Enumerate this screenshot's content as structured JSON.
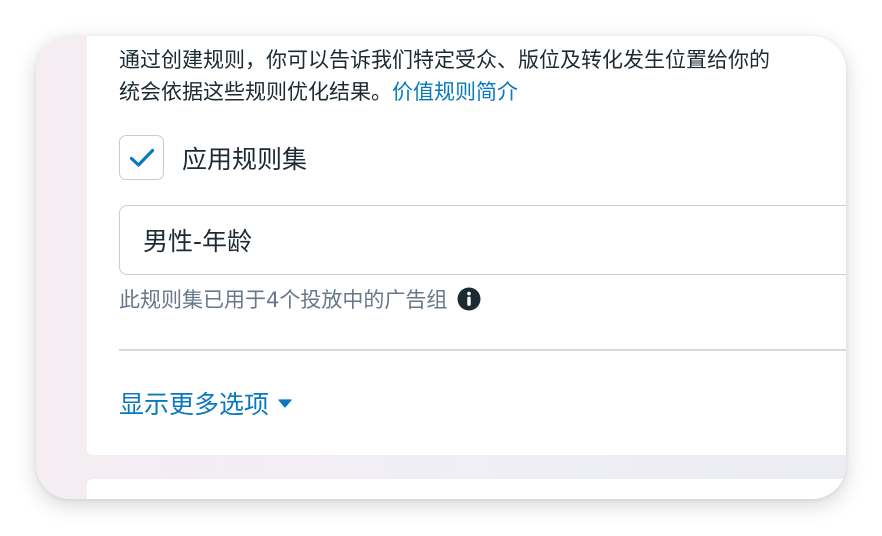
{
  "rules": {
    "description_line1": "通过创建规则，你可以告诉我们特定受众、版位及转化发生位置给你的",
    "description_line2": "统会依据这些规则优化结果。",
    "learn_more_link": "价值规则简介"
  },
  "rule_set": {
    "checkbox_label": "应用规则集",
    "checked": true,
    "selected_value": "男性-年龄",
    "usage_text": "此规则集已用于4个投放中的广告组"
  },
  "more_options_label": "显示更多选项",
  "icons": {
    "checkbox": "checkmark-icon",
    "info": "info-icon",
    "more_options": "caret-down-icon"
  },
  "colors": {
    "link": "#0a78be",
    "text_primary": "#1c2b33",
    "text_secondary": "#67788a",
    "border": "#c9cdd2"
  }
}
